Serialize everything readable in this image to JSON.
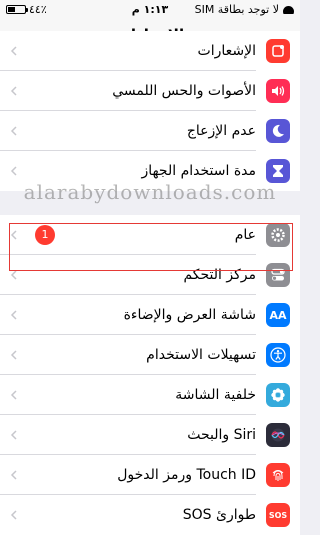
{
  "status_bar": {
    "carrier": "لا توجد بطاقة SIM",
    "time": "١:١٣ م",
    "battery_text": "٤٤٪",
    "battery_level": 0.44
  },
  "nav": {
    "title": "الإعدادات"
  },
  "rows_group1": [
    {
      "label": "الإشعارات",
      "icon": "notifications-icon",
      "color": "#ff3b30"
    },
    {
      "label": "الأصوات والحس اللمسي",
      "icon": "sounds-icon",
      "color": "#ff2d55"
    },
    {
      "label": "عدم الإزعاج",
      "icon": "moon-icon",
      "color": "#5856d6"
    },
    {
      "label": "مدة استخدام الجهاز",
      "icon": "hourglass-icon",
      "color": "#5856d6"
    }
  ],
  "rows_group2": [
    {
      "label": "عام",
      "icon": "gear-icon",
      "color": "#8e8e93",
      "badge": "1"
    },
    {
      "label": "مركز التحكم",
      "icon": "control-center-icon",
      "color": "#8e8e93"
    },
    {
      "label": "شاشة العرض والإضاءة",
      "icon": "display-icon",
      "color": "#007aff",
      "icon_text": "AA"
    },
    {
      "label": "تسهيلات الاستخدام",
      "icon": "accessibility-icon",
      "color": "#007aff"
    },
    {
      "label": "خلفية الشاشة",
      "icon": "wallpaper-icon",
      "color": "#34aadc"
    },
    {
      "label": "Siri والبحث",
      "icon": "siri-icon",
      "color": "#2c2c3a"
    },
    {
      "label": "Touch ID ورمز الدخول",
      "icon": "fingerprint-icon",
      "color": "#ff3b30"
    },
    {
      "label": "طوارئ SOS",
      "icon": "sos-icon",
      "color": "#ff3b30",
      "icon_text": "SOS"
    }
  ],
  "watermark": "alarabydownloads.com"
}
